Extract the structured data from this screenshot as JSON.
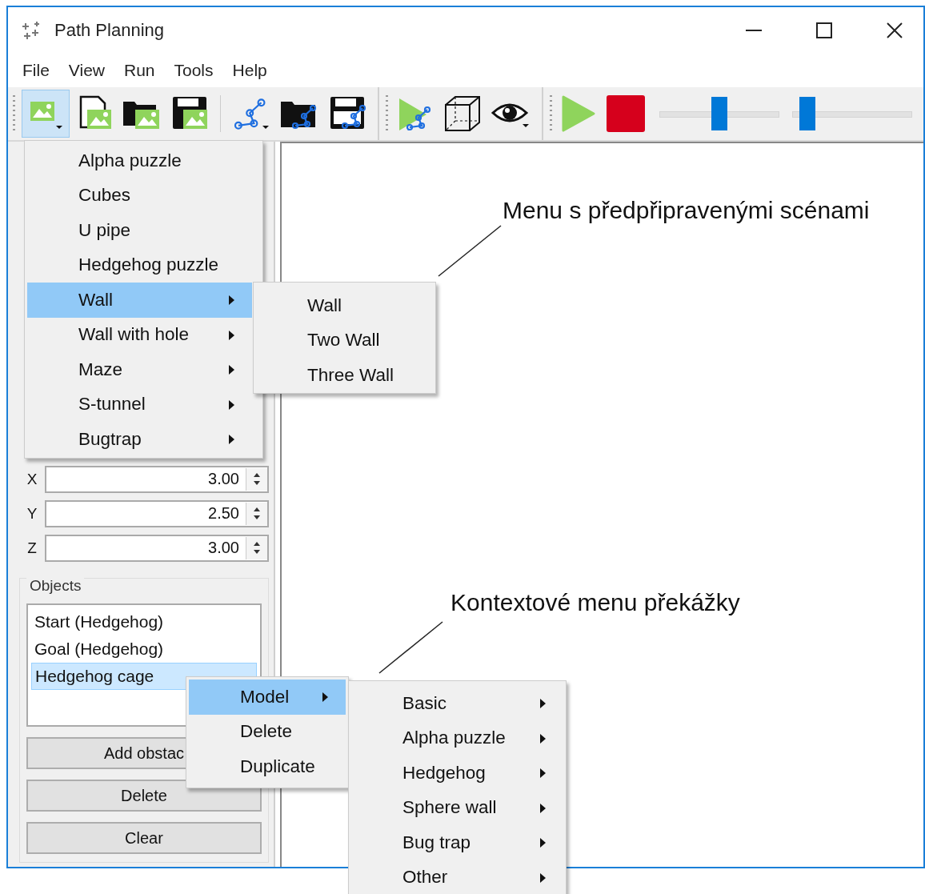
{
  "window": {
    "title": "Path Planning"
  },
  "menubar": [
    "File",
    "View",
    "Run",
    "Tools",
    "Help"
  ],
  "toolbar": {
    "scene_button": {
      "selected": true
    },
    "sliders": [
      {
        "level": 0.5
      },
      {
        "level": 0.07
      }
    ]
  },
  "scene_menu": [
    {
      "label": "Alpha puzzle",
      "submenu": false,
      "selected": false
    },
    {
      "label": "Cubes",
      "submenu": false,
      "selected": false
    },
    {
      "label": "U pipe",
      "submenu": false,
      "selected": false
    },
    {
      "label": "Hedgehog puzzle",
      "submenu": false,
      "selected": false
    },
    {
      "label": "Wall",
      "submenu": true,
      "selected": true
    },
    {
      "label": "Wall with hole",
      "submenu": true,
      "selected": false
    },
    {
      "label": "Maze",
      "submenu": true,
      "selected": false
    },
    {
      "label": "S-tunnel",
      "submenu": true,
      "selected": false
    },
    {
      "label": "Bugtrap",
      "submenu": true,
      "selected": false
    }
  ],
  "wall_submenu": [
    {
      "label": "Wall",
      "submenu": false,
      "selected": false
    },
    {
      "label": "Two Wall",
      "submenu": false,
      "selected": false
    },
    {
      "label": "Three Wall",
      "submenu": false,
      "selected": false
    }
  ],
  "coordinates": [
    {
      "label": "X",
      "value": "3.00"
    },
    {
      "label": "Y",
      "value": "2.50"
    },
    {
      "label": "Z",
      "value": "3.00"
    }
  ],
  "objects": {
    "title": "Objects",
    "items": [
      {
        "label": "Start (Hedgehog)",
        "selected": false
      },
      {
        "label": "Goal (Hedgehog)",
        "selected": false
      },
      {
        "label": "Hedgehog cage",
        "selected": true
      }
    ]
  },
  "buttons": [
    "Add obstac",
    "Delete",
    "Clear"
  ],
  "context_menu": [
    {
      "label": "Model",
      "submenu": true,
      "selected": true
    },
    {
      "label": "Delete",
      "submenu": false,
      "selected": false
    },
    {
      "label": "Duplicate",
      "submenu": false,
      "selected": false
    }
  ],
  "model_submenu": [
    {
      "label": "Basic",
      "submenu": true,
      "selected": false
    },
    {
      "label": "Alpha puzzle",
      "submenu": true,
      "selected": false
    },
    {
      "label": "Hedgehog",
      "submenu": true,
      "selected": false
    },
    {
      "label": "Sphere wall",
      "submenu": true,
      "selected": false
    },
    {
      "label": "Bug trap",
      "submenu": true,
      "selected": false
    },
    {
      "label": "Other",
      "submenu": true,
      "selected": false
    }
  ],
  "annotations": [
    "Menu s předpřipravenými scénami",
    "Kontextové menu překážky"
  ]
}
